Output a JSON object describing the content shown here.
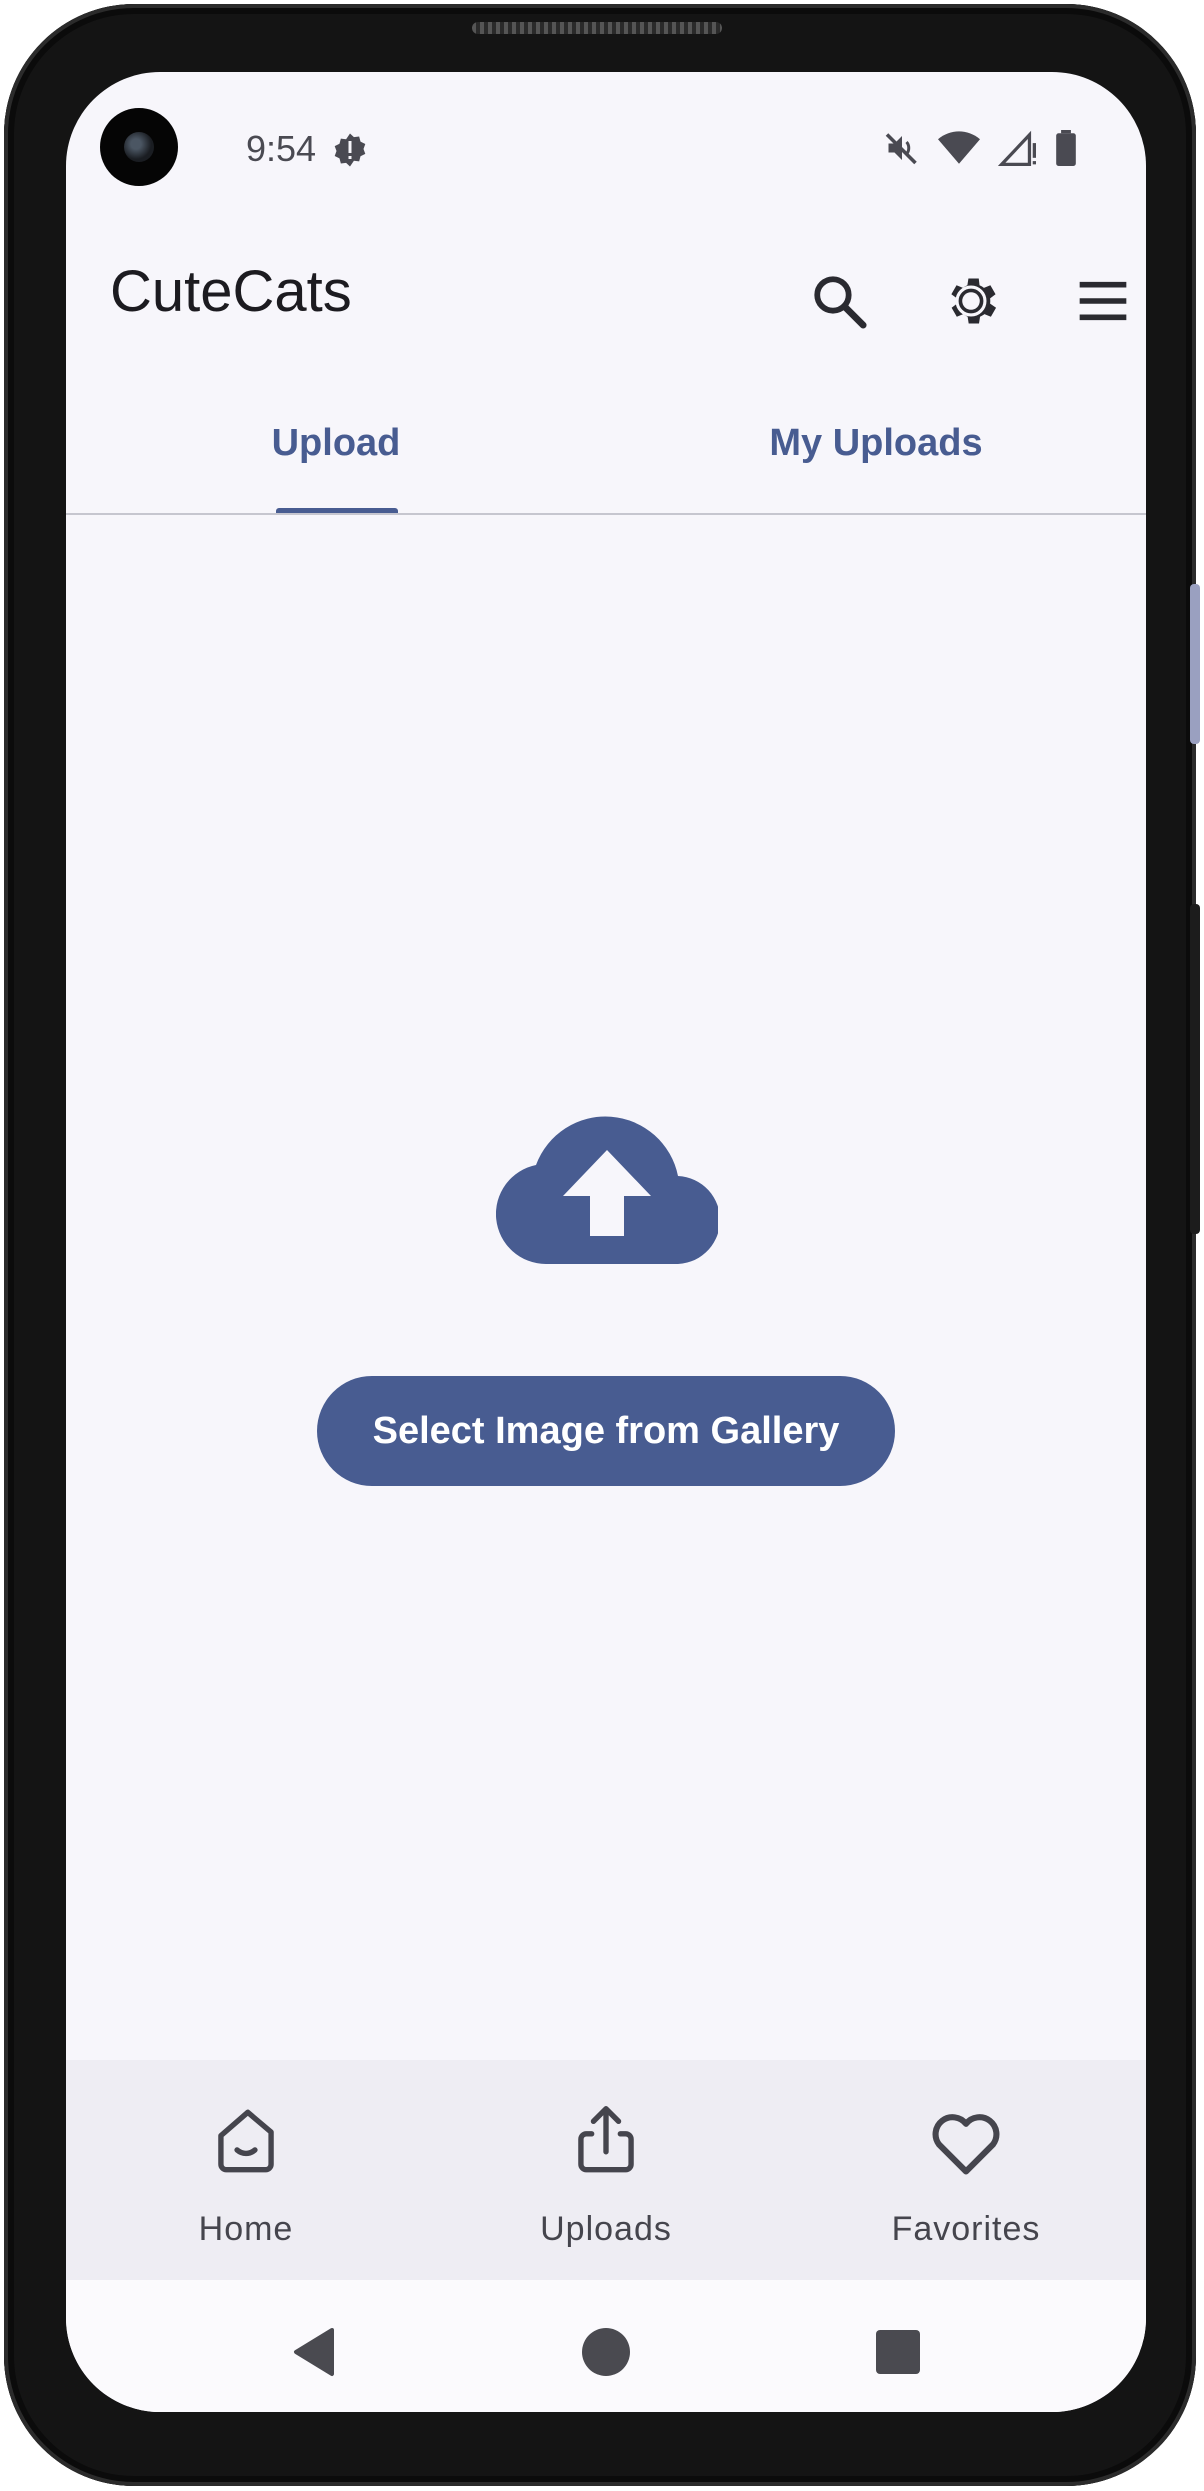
{
  "status_bar": {
    "time": "9:54",
    "icons": [
      "camera-cutout",
      "alert-badge-icon",
      "mute-icon",
      "wifi-icon",
      "signal-icon",
      "battery-icon"
    ]
  },
  "app_bar": {
    "title": "CuteCats",
    "actions": [
      "search-icon",
      "settings-icon",
      "menu-icon"
    ]
  },
  "tabs": [
    {
      "label": "Upload",
      "selected": true
    },
    {
      "label": "My Uploads",
      "selected": false
    }
  ],
  "main": {
    "icon": "cloud-upload-icon",
    "button_label": "Select Image from Gallery"
  },
  "bottom_nav": {
    "items": [
      {
        "label": "Home",
        "icon": "home-icon"
      },
      {
        "label": "Uploads",
        "icon": "upload-icon"
      },
      {
        "label": "Favorites",
        "icon": "heart-icon"
      }
    ]
  },
  "colors": {
    "primary": "#485c91",
    "background": "#f7f6fb",
    "nav_background": "#eeedf3",
    "text": "#1c1b20"
  }
}
